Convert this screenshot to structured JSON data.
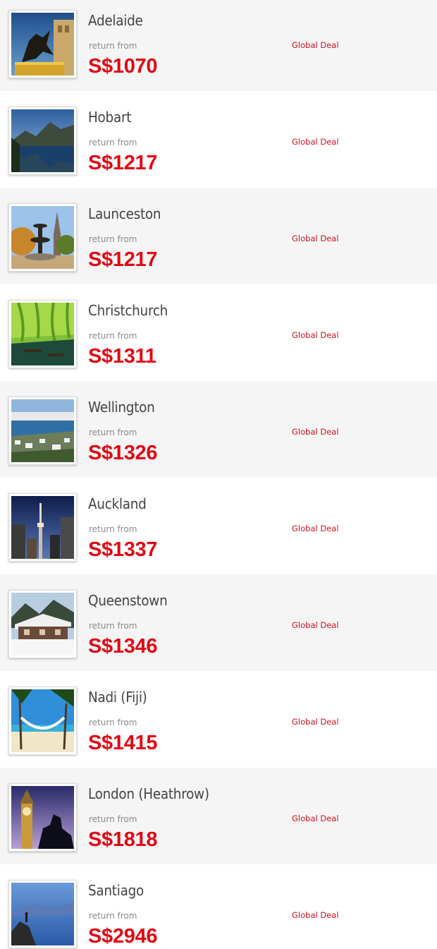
{
  "deals": [
    {
      "city": "Adelaide",
      "return_label": "return from",
      "price": "S$1070",
      "badge": "Global Deal",
      "image": "statue-photo"
    },
    {
      "city": "Hobart",
      "return_label": "return from",
      "price": "S$1217",
      "badge": "Global Deal",
      "image": "lake-mountain-photo"
    },
    {
      "city": "Launceston",
      "return_label": "return from",
      "price": "S$1217",
      "badge": "Global Deal",
      "image": "fountain-park-photo"
    },
    {
      "city": "Christchurch",
      "return_label": "return from",
      "price": "S$1311",
      "badge": "Global Deal",
      "image": "river-punting-photo"
    },
    {
      "city": "Wellington",
      "return_label": "return from",
      "price": "S$1326",
      "badge": "Global Deal",
      "image": "harbour-city-photo"
    },
    {
      "city": "Auckland",
      "return_label": "return from",
      "price": "S$1337",
      "badge": "Global Deal",
      "image": "sky-tower-photo"
    },
    {
      "city": "Queenstown",
      "return_label": "return from",
      "price": "S$1346",
      "badge": "Global Deal",
      "image": "snow-lodge-photo"
    },
    {
      "city": "Nadi (Fiji)",
      "return_label": "return from",
      "price": "S$1415",
      "badge": "Global Deal",
      "image": "beach-hammock-photo"
    },
    {
      "city": "London (Heathrow)",
      "return_label": "return from",
      "price": "S$1818",
      "badge": "Global Deal",
      "image": "big-ben-photo"
    },
    {
      "city": "Santiago",
      "return_label": "return from",
      "price": "S$2946",
      "badge": "Global Deal",
      "image": "mountain-lake-photo"
    }
  ],
  "colors": {
    "price": "#e20613",
    "badge": "#d01020",
    "city": "#444444",
    "return_label": "#8a8a8a",
    "row_shaded": "#f5f5f5",
    "row_plain": "#ffffff"
  }
}
